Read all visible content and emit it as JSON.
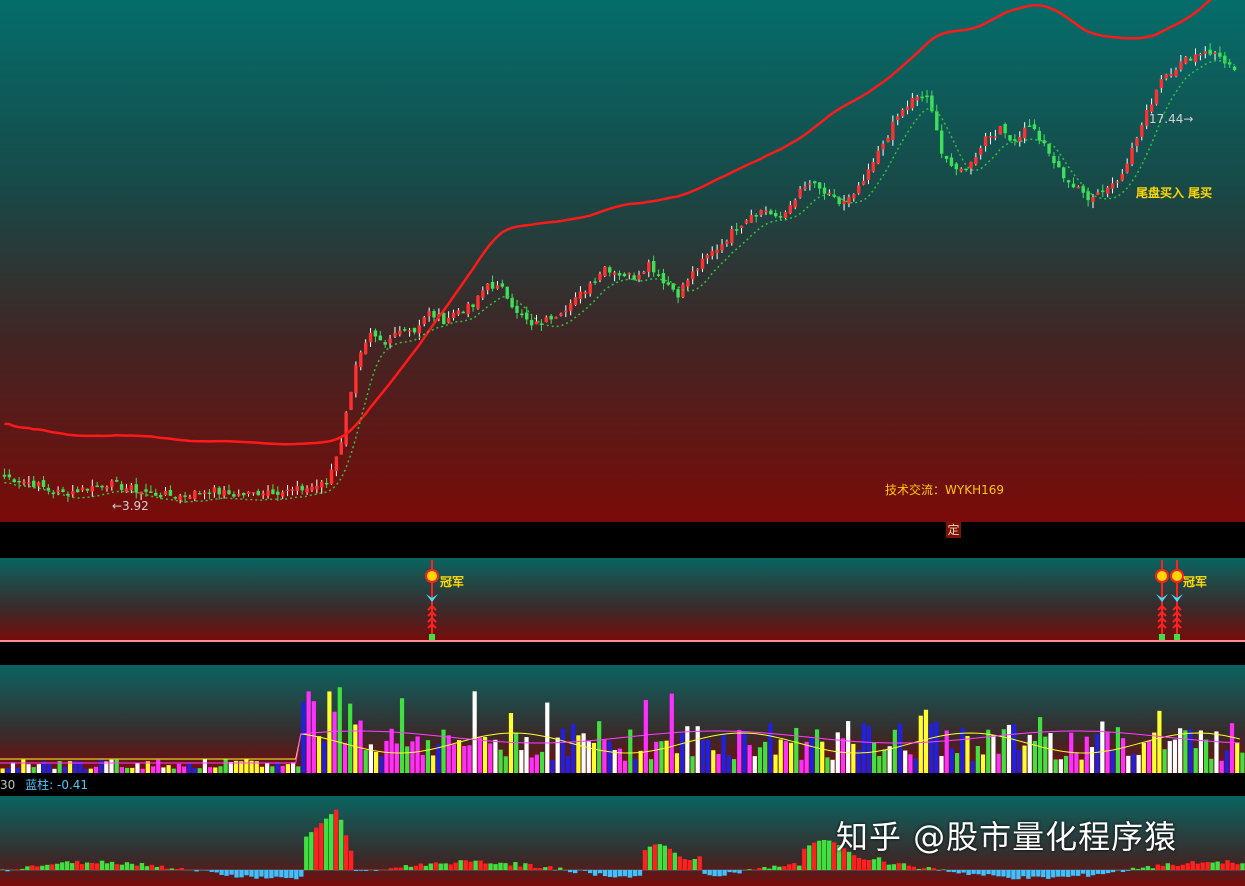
{
  "main": {
    "low_label": "←3.92",
    "high_label": "17.44→",
    "signal_label": "尾盘买入 尾买",
    "contact_label": "技术交流：WYKH169",
    "marker_label": "定"
  },
  "signals": {
    "label": "冠军"
  },
  "macd": {
    "header_prefix": "30",
    "header_label": "蓝柱:",
    "header_value": "-0.41"
  },
  "watermark": "知乎 @股市量化程序猿",
  "colors": {
    "up": "#ff3030",
    "down": "#3ee05a",
    "ma_long": "#ff1a1a",
    "ma_short": "#30c040",
    "vol_yellow": "#ffff30",
    "vol_magenta": "#ff30ff",
    "vol_white": "#ffffff",
    "vol_blue": "#2020e0",
    "macd_pos": "#ff2020",
    "macd_neg": "#40c0ff",
    "label_gold": "#ffd700",
    "contact": "#ffc800"
  },
  "chart_data": [
    {
      "type": "candlestick",
      "price_range": [
        3.5,
        18.5
      ],
      "min_label": 3.92,
      "max_label": 17.44,
      "closes": [
        4.5,
        4.4,
        4.3,
        4.1,
        4.0,
        4.1,
        4.2,
        4.3,
        4.2,
        4.1,
        4.0,
        3.95,
        3.92,
        4.0,
        4.1,
        4.0,
        3.95,
        4.0,
        4.1,
        4.05,
        4.1,
        4.2,
        4.3,
        5.6,
        7.9,
        8.7,
        8.4,
        9.0,
        8.9,
        9.4,
        9.2,
        9.5,
        9.6,
        10.3,
        10.1,
        9.5,
        9.0,
        9.2,
        9.5,
        9.8,
        10.3,
        10.8,
        10.6,
        10.5,
        10.9,
        10.4,
        10.0,
        10.6,
        11.1,
        11.5,
        12.0,
        12.4,
        12.5,
        12.2,
        12.9,
        13.3,
        13.0,
        12.7,
        12.9,
        13.6,
        14.5,
        15.3,
        15.8,
        15.9,
        14.3,
        13.6,
        13.9,
        14.7,
        14.9,
        14.6,
        15.1,
        14.4,
        13.7,
        13.2,
        12.9,
        13.1,
        13.4,
        14.3,
        15.4,
        16.5,
        16.8,
        17.1,
        17.3,
        17.1,
        16.7
      ],
      "ma_long_range": [
        10.6,
        16.9
      ],
      "ma_short": "dotted trailing line"
    },
    {
      "type": "signal",
      "label": "冠军",
      "positions": [
        432,
        1162,
        1177
      ]
    },
    {
      "type": "bar",
      "series": [
        {
          "name": "",
          "color": "#ffff30"
        },
        {
          "name": "",
          "color": "#ff30ff"
        },
        {
          "name": "",
          "color": "#ffffff"
        },
        {
          "name": "",
          "color": "#2020e0"
        }
      ]
    },
    {
      "type": "bar",
      "label": "蓝柱",
      "value": -0.41
    }
  ]
}
